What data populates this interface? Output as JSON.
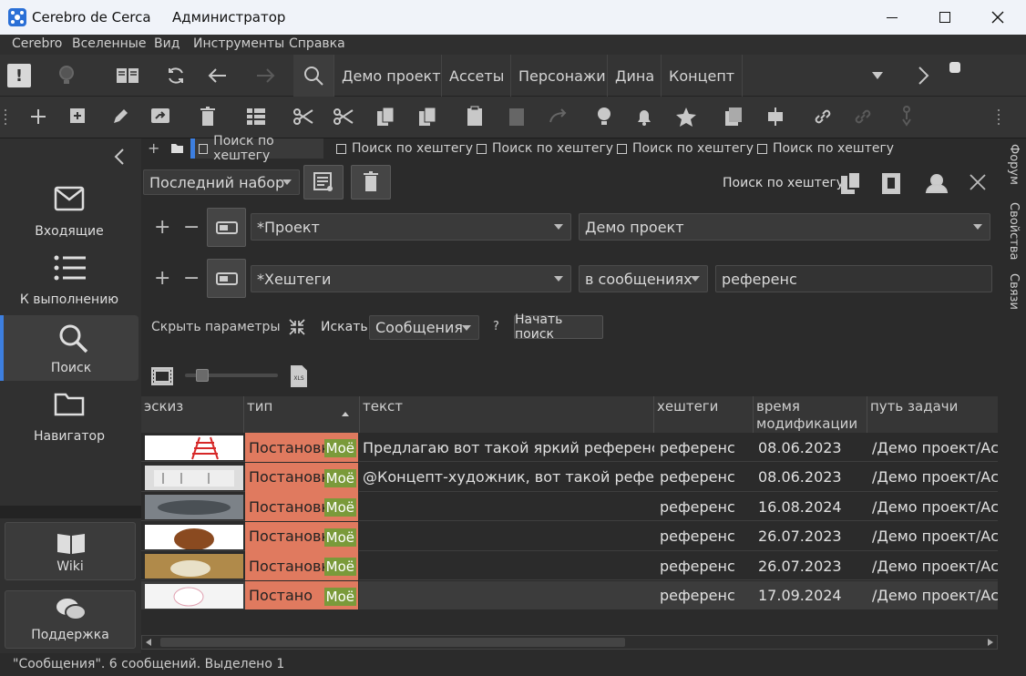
{
  "window": {
    "app_title": "Cerebro de Cerca",
    "user_role": "Администратор"
  },
  "menu": [
    "Cerebro",
    "Вселенные",
    "Вид",
    "Инструменты",
    "Справка"
  ],
  "toolbar1": {
    "nav_tabs": [
      "Демо проект",
      "Ассеты",
      "Персонажи",
      "Дина",
      "Концепт"
    ]
  },
  "sidebar": {
    "items": [
      {
        "label": "Входящие",
        "icon": "mail-icon"
      },
      {
        "label": "К выполнению",
        "icon": "list-icon"
      },
      {
        "label": "Поиск",
        "icon": "search-icon"
      },
      {
        "label": "Навигатор",
        "icon": "folder-icon"
      }
    ],
    "wiki_label": "Wiki",
    "support_label": "Поддержка"
  },
  "doc_tabs": [
    "Поиск по хештегу",
    "Поиск по хештегу",
    "Поиск по хештегу",
    "Поиск по хештегу",
    "Поиск по хештегу"
  ],
  "search": {
    "preset": "Последний набор",
    "panel_title": "Поиск по хештегу",
    "filter1_field": "*Проект",
    "filter1_value": "Демо проект",
    "filter2_field": "*Хештеги",
    "filter2_scope": "в сообщениях",
    "filter2_value": "референс",
    "hide_params": "Скрыть параметры",
    "search_in_label": "Искать",
    "search_in_value": "Сообщения",
    "help": "?",
    "start_button": "Начать поиск",
    "xls_label": "XLS"
  },
  "table": {
    "columns": [
      "эскиз",
      "тип",
      "текст",
      "хештеги",
      "время модификации",
      "путь задачи"
    ],
    "moe_label": "Моё",
    "rows": [
      {
        "type": "Постановк",
        "text": "Предлагаю вот такой яркий референс.",
        "tags": "референс",
        "date": "08.06.2023",
        "path": "/Демо проект/Асс"
      },
      {
        "type": "Постановк",
        "text": "@Концепт-художник, вот такой рефернес",
        "tags": "референс",
        "date": "08.06.2023",
        "path": "/Демо проект/Асс"
      },
      {
        "type": "Постановк",
        "text": "",
        "tags": "референс",
        "date": "16.08.2024",
        "path": "/Демо проект/Асс"
      },
      {
        "type": "Постановк",
        "text": "",
        "tags": "референс",
        "date": "26.07.2023",
        "path": "/Демо проект/Асс"
      },
      {
        "type": "Постановк",
        "text": "",
        "tags": "референс",
        "date": "26.07.2023",
        "path": "/Демо проект/Асс"
      },
      {
        "type": "Постано",
        "text": "",
        "tags": "референс",
        "date": "17.09.2024",
        "path": "/Демо проект/Асс"
      }
    ]
  },
  "right_strip": [
    "Форум",
    "Свойства",
    "Связи"
  ],
  "status": "\"Сообщения\". 6 сообщений. Выделено 1",
  "colors": {
    "accent": "#3d7fe0",
    "type_cell": "#e07a5f",
    "moe_badge": "#7a9a3a"
  }
}
